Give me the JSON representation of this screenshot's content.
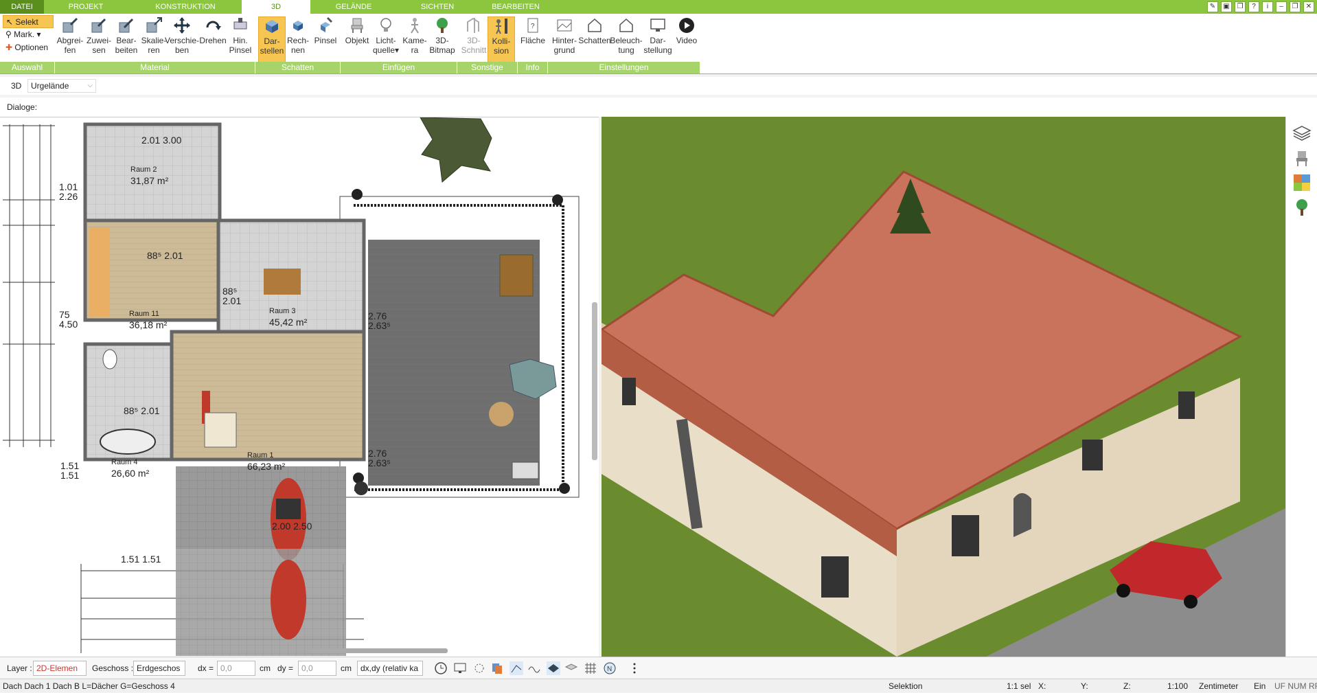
{
  "tabs": [
    {
      "label": "DATEI",
      "active": false
    },
    {
      "label": "PROJEKT",
      "active": false
    },
    {
      "label": "KONSTRUKTION",
      "active": false
    },
    {
      "label": "3D",
      "active": true
    },
    {
      "label": "GELÄNDE",
      "active": false
    },
    {
      "label": "SICHTEN",
      "active": false
    },
    {
      "label": "BEARBEITEN",
      "active": false
    }
  ],
  "ribbon": {
    "selection": {
      "select": "Selekt",
      "mark": "Mark.",
      "options": "Optionen"
    },
    "buttons": [
      {
        "l1": "Abgrei-",
        "l2": "fen"
      },
      {
        "l1": "Zuwei-",
        "l2": "sen"
      },
      {
        "l1": "Bear-",
        "l2": "beiten"
      },
      {
        "l1": "Skalie-",
        "l2": "ren"
      },
      {
        "l1": "Verschie-",
        "l2": "ben"
      },
      {
        "l1": "Drehen",
        "l2": ""
      },
      {
        "l1": "Hin.",
        "l2": "Pinsel"
      },
      {
        "l1": "Dar-",
        "l2": "stellen"
      },
      {
        "l1": "Rech-",
        "l2": "nen"
      },
      {
        "l1": "Pinsel",
        "l2": ""
      },
      {
        "l1": "Objekt",
        "l2": ""
      },
      {
        "l1": "Licht-",
        "l2": "quelle"
      },
      {
        "l1": "Kame-",
        "l2": "ra"
      },
      {
        "l1": "3D-",
        "l2": "Bitmap"
      },
      {
        "l1": "3D-",
        "l2": "Schnitt"
      },
      {
        "l1": "Kolli-",
        "l2": "sion"
      },
      {
        "l1": "Fläche",
        "l2": ""
      },
      {
        "l1": "Hinter-",
        "l2": "grund"
      },
      {
        "l1": "Schatten",
        "l2": ""
      },
      {
        "l1": "Beleuch-",
        "l2": "tung"
      },
      {
        "l1": "Dar-",
        "l2": "stellung"
      },
      {
        "l1": "Video",
        "l2": ""
      }
    ],
    "groups": [
      "Auswahl",
      "Material",
      "Schatten",
      "Einfügen",
      "Sonstige",
      "Info",
      "Einstellungen"
    ]
  },
  "bar3d": {
    "label": "3D",
    "terrain": "Urgelände"
  },
  "dialog_label": "Dialoge:",
  "plan": {
    "rooms": [
      {
        "name": "Raum 2",
        "area": "31,87 m²"
      },
      {
        "name": "Raum 11",
        "area": "36,18 m²"
      },
      {
        "name": "Raum 3",
        "area": "45,42 m²"
      },
      {
        "name": "Raum 4",
        "area": "26,60 m²"
      },
      {
        "name": "Raum 1",
        "area": "66,23 m²"
      }
    ],
    "dims": [
      "2.01",
      "3.00",
      "1.01",
      "2.26",
      "88⁵",
      "2.01",
      "88⁵",
      "2.01",
      "75",
      "4.50",
      "2.76",
      "2.63⁵",
      "88⁵",
      "2.01",
      "1.51",
      "1.51",
      "2.76",
      "2.63⁵",
      "2.00",
      "2.50",
      "1.51",
      "1.51"
    ]
  },
  "toolbar": {
    "layer_label": "Layer :",
    "layer_value": "2D-Elemen",
    "floor_label": "Geschoss :",
    "floor_value": "Erdgeschos",
    "dx_label": "dx =",
    "dx_value": "0,0",
    "unit1": "cm",
    "dy_label": "dy =",
    "dy_value": "0,0",
    "unit2": "cm",
    "mode_value": "dx,dy (relativ ka"
  },
  "status": {
    "left": "Dach Dach 1 Dach B L=Dächer G=Geschoss 4",
    "mode": "Selektion",
    "sel": "1:1 sel",
    "x": "X:",
    "y": "Y:",
    "z": "Z:",
    "scale": "1:100",
    "unit": "Zentimeter",
    "ein": "Ein",
    "flags": "UF NUM RF"
  },
  "colors": {
    "accent_green": "#8cc63f",
    "active_button": "#f7c652",
    "roof": "#c9735c",
    "wall": "#e8dcc6"
  }
}
